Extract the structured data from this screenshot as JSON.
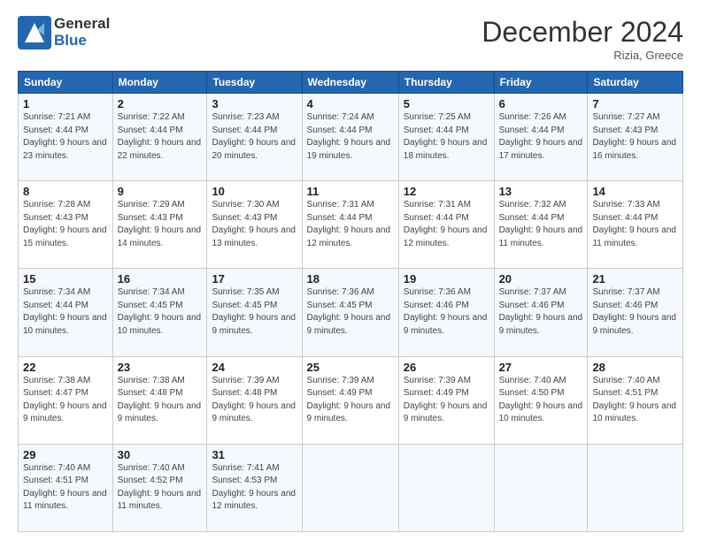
{
  "header": {
    "logo_line1": "General",
    "logo_line2": "Blue",
    "month_title": "December 2024",
    "location": "Rizia, Greece"
  },
  "weekdays": [
    "Sunday",
    "Monday",
    "Tuesday",
    "Wednesday",
    "Thursday",
    "Friday",
    "Saturday"
  ],
  "weeks": [
    [
      {
        "day": "1",
        "sunrise": "Sunrise: 7:21 AM",
        "sunset": "Sunset: 4:44 PM",
        "daylight": "Daylight: 9 hours and 23 minutes."
      },
      {
        "day": "2",
        "sunrise": "Sunrise: 7:22 AM",
        "sunset": "Sunset: 4:44 PM",
        "daylight": "Daylight: 9 hours and 22 minutes."
      },
      {
        "day": "3",
        "sunrise": "Sunrise: 7:23 AM",
        "sunset": "Sunset: 4:44 PM",
        "daylight": "Daylight: 9 hours and 20 minutes."
      },
      {
        "day": "4",
        "sunrise": "Sunrise: 7:24 AM",
        "sunset": "Sunset: 4:44 PM",
        "daylight": "Daylight: 9 hours and 19 minutes."
      },
      {
        "day": "5",
        "sunrise": "Sunrise: 7:25 AM",
        "sunset": "Sunset: 4:44 PM",
        "daylight": "Daylight: 9 hours and 18 minutes."
      },
      {
        "day": "6",
        "sunrise": "Sunrise: 7:26 AM",
        "sunset": "Sunset: 4:44 PM",
        "daylight": "Daylight: 9 hours and 17 minutes."
      },
      {
        "day": "7",
        "sunrise": "Sunrise: 7:27 AM",
        "sunset": "Sunset: 4:43 PM",
        "daylight": "Daylight: 9 hours and 16 minutes."
      }
    ],
    [
      {
        "day": "8",
        "sunrise": "Sunrise: 7:28 AM",
        "sunset": "Sunset: 4:43 PM",
        "daylight": "Daylight: 9 hours and 15 minutes."
      },
      {
        "day": "9",
        "sunrise": "Sunrise: 7:29 AM",
        "sunset": "Sunset: 4:43 PM",
        "daylight": "Daylight: 9 hours and 14 minutes."
      },
      {
        "day": "10",
        "sunrise": "Sunrise: 7:30 AM",
        "sunset": "Sunset: 4:43 PM",
        "daylight": "Daylight: 9 hours and 13 minutes."
      },
      {
        "day": "11",
        "sunrise": "Sunrise: 7:31 AM",
        "sunset": "Sunset: 4:44 PM",
        "daylight": "Daylight: 9 hours and 12 minutes."
      },
      {
        "day": "12",
        "sunrise": "Sunrise: 7:31 AM",
        "sunset": "Sunset: 4:44 PM",
        "daylight": "Daylight: 9 hours and 12 minutes."
      },
      {
        "day": "13",
        "sunrise": "Sunrise: 7:32 AM",
        "sunset": "Sunset: 4:44 PM",
        "daylight": "Daylight: 9 hours and 11 minutes."
      },
      {
        "day": "14",
        "sunrise": "Sunrise: 7:33 AM",
        "sunset": "Sunset: 4:44 PM",
        "daylight": "Daylight: 9 hours and 11 minutes."
      }
    ],
    [
      {
        "day": "15",
        "sunrise": "Sunrise: 7:34 AM",
        "sunset": "Sunset: 4:44 PM",
        "daylight": "Daylight: 9 hours and 10 minutes."
      },
      {
        "day": "16",
        "sunrise": "Sunrise: 7:34 AM",
        "sunset": "Sunset: 4:45 PM",
        "daylight": "Daylight: 9 hours and 10 minutes."
      },
      {
        "day": "17",
        "sunrise": "Sunrise: 7:35 AM",
        "sunset": "Sunset: 4:45 PM",
        "daylight": "Daylight: 9 hours and 9 minutes."
      },
      {
        "day": "18",
        "sunrise": "Sunrise: 7:36 AM",
        "sunset": "Sunset: 4:45 PM",
        "daylight": "Daylight: 9 hours and 9 minutes."
      },
      {
        "day": "19",
        "sunrise": "Sunrise: 7:36 AM",
        "sunset": "Sunset: 4:46 PM",
        "daylight": "Daylight: 9 hours and 9 minutes."
      },
      {
        "day": "20",
        "sunrise": "Sunrise: 7:37 AM",
        "sunset": "Sunset: 4:46 PM",
        "daylight": "Daylight: 9 hours and 9 minutes."
      },
      {
        "day": "21",
        "sunrise": "Sunrise: 7:37 AM",
        "sunset": "Sunset: 4:46 PM",
        "daylight": "Daylight: 9 hours and 9 minutes."
      }
    ],
    [
      {
        "day": "22",
        "sunrise": "Sunrise: 7:38 AM",
        "sunset": "Sunset: 4:47 PM",
        "daylight": "Daylight: 9 hours and 9 minutes."
      },
      {
        "day": "23",
        "sunrise": "Sunrise: 7:38 AM",
        "sunset": "Sunset: 4:48 PM",
        "daylight": "Daylight: 9 hours and 9 minutes."
      },
      {
        "day": "24",
        "sunrise": "Sunrise: 7:39 AM",
        "sunset": "Sunset: 4:48 PM",
        "daylight": "Daylight: 9 hours and 9 minutes."
      },
      {
        "day": "25",
        "sunrise": "Sunrise: 7:39 AM",
        "sunset": "Sunset: 4:49 PM",
        "daylight": "Daylight: 9 hours and 9 minutes."
      },
      {
        "day": "26",
        "sunrise": "Sunrise: 7:39 AM",
        "sunset": "Sunset: 4:49 PM",
        "daylight": "Daylight: 9 hours and 9 minutes."
      },
      {
        "day": "27",
        "sunrise": "Sunrise: 7:40 AM",
        "sunset": "Sunset: 4:50 PM",
        "daylight": "Daylight: 9 hours and 10 minutes."
      },
      {
        "day": "28",
        "sunrise": "Sunrise: 7:40 AM",
        "sunset": "Sunset: 4:51 PM",
        "daylight": "Daylight: 9 hours and 10 minutes."
      }
    ],
    [
      {
        "day": "29",
        "sunrise": "Sunrise: 7:40 AM",
        "sunset": "Sunset: 4:51 PM",
        "daylight": "Daylight: 9 hours and 11 minutes."
      },
      {
        "day": "30",
        "sunrise": "Sunrise: 7:40 AM",
        "sunset": "Sunset: 4:52 PM",
        "daylight": "Daylight: 9 hours and 11 minutes."
      },
      {
        "day": "31",
        "sunrise": "Sunrise: 7:41 AM",
        "sunset": "Sunset: 4:53 PM",
        "daylight": "Daylight: 9 hours and 12 minutes."
      },
      null,
      null,
      null,
      null
    ]
  ]
}
